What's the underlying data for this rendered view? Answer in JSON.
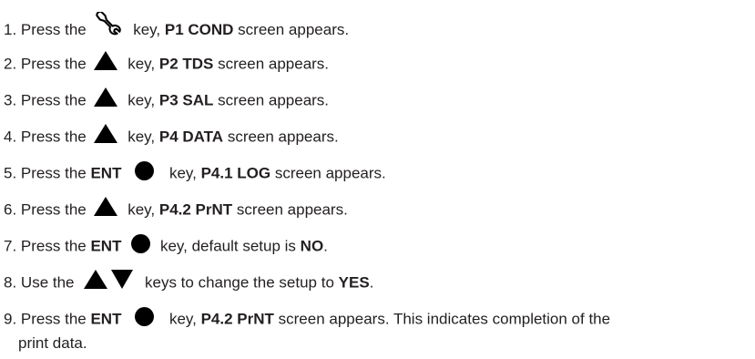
{
  "steps": [
    {
      "num": "1.",
      "pre": "Press the",
      "icons": [
        "wrench-icon"
      ],
      "mid": "key,",
      "bold": "P1 COND",
      "post": "screen appears."
    },
    {
      "num": "2.",
      "pre": "Press the",
      "icons": [
        "up-arrow-icon"
      ],
      "mid": "key,",
      "bold": "P2 TDS",
      "post": "screen appears."
    },
    {
      "num": "3.",
      "pre": "Press the",
      "icons": [
        "up-arrow-icon"
      ],
      "mid": "key,",
      "bold": "P3 SAL",
      "post": "screen appears."
    },
    {
      "num": "4.",
      "pre": "Press the",
      "icons": [
        "up-arrow-icon"
      ],
      "mid": "key,",
      "bold": "P4 DATA",
      "post": "screen appears."
    },
    {
      "num": "5.",
      "pre": "Press the",
      "key_bold": "ENT",
      "icons": [
        "enter-circle-icon"
      ],
      "mid": "key,",
      "bold": "P4.1 LOG",
      "post": "screen appears."
    },
    {
      "num": "6.",
      "pre": "Press the",
      "icons": [
        "up-arrow-icon"
      ],
      "mid": "key,",
      "bold": "P4.2 PrNT",
      "post": "screen appears."
    },
    {
      "num": "7.",
      "pre": "Press the",
      "key_bold": "ENT",
      "icons": [
        "enter-circle-icon"
      ],
      "mid": "key, default setup is",
      "bold": "NO",
      "post": "."
    },
    {
      "num": "8.",
      "pre": "Use the",
      "icons": [
        "up-arrow-icon",
        "down-arrow-icon"
      ],
      "mid": "keys to change the setup to",
      "bold": "YES",
      "post": "."
    },
    {
      "num": "9.",
      "pre": "Press the",
      "key_bold": "ENT",
      "icons": [
        "enter-circle-icon"
      ],
      "mid": "key,",
      "bold": "P4.2 PrNT",
      "post": "screen appears. This indicates completion of the",
      "continuation": "print data."
    }
  ],
  "colors": {
    "text": "#231f20",
    "icon": "#000000",
    "background": "#ffffff"
  }
}
